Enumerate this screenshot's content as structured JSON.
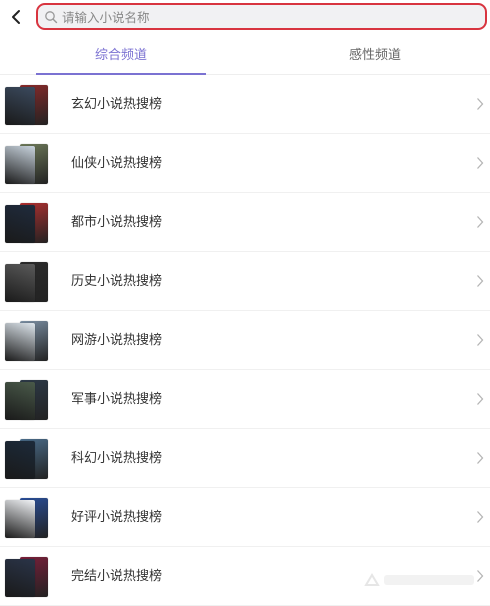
{
  "search": {
    "placeholder": "请输入小说名称"
  },
  "tabs": [
    {
      "label": "综合频道"
    },
    {
      "label": "感性频道"
    }
  ],
  "colors": {
    "accent": "#7b72d2",
    "search_border": "#d8343f"
  },
  "list": {
    "items": [
      {
        "label": "玄幻小说热搜榜",
        "cover_colors": [
          "#3b4a5e",
          "#8a2a2a"
        ]
      },
      {
        "label": "仙侠小说热搜榜",
        "cover_colors": [
          "#c9d4de",
          "#6e7a5a"
        ]
      },
      {
        "label": "都市小说热搜榜",
        "cover_colors": [
          "#1f2b3d",
          "#b03030"
        ]
      },
      {
        "label": "历史小说热搜榜",
        "cover_colors": [
          "#5a5a5a",
          "#2b2b2b"
        ]
      },
      {
        "label": "网游小说热搜榜",
        "cover_colors": [
          "#dfe7ee",
          "#7b8fa3"
        ]
      },
      {
        "label": "军事小说热搜榜",
        "cover_colors": [
          "#4a5a4a",
          "#2d3a48"
        ]
      },
      {
        "label": "科幻小说热搜榜",
        "cover_colors": [
          "#1c2a3a",
          "#4a6c8a"
        ]
      },
      {
        "label": "好评小说热搜榜",
        "cover_colors": [
          "#f3f5f8",
          "#2a4f9a"
        ]
      },
      {
        "label": "完结小说热搜榜",
        "cover_colors": [
          "#2a3448",
          "#7a1f3a"
        ]
      }
    ]
  }
}
